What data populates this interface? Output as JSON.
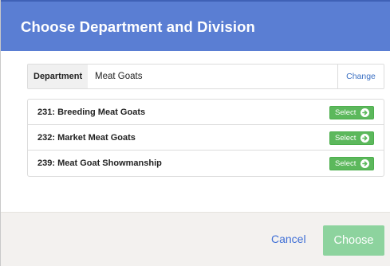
{
  "modal": {
    "title": "Choose Department and Division"
  },
  "department": {
    "label": "Department",
    "value": "Meat Goats",
    "change_label": "Change"
  },
  "divisions": [
    {
      "name": "231: Breeding Meat Goats",
      "select_label": "Select"
    },
    {
      "name": "232: Market Meat Goats",
      "select_label": "Select"
    },
    {
      "name": "239: Meat Goat Showmanship",
      "select_label": "Select"
    }
  ],
  "footer": {
    "cancel_label": "Cancel",
    "choose_label": "Choose"
  },
  "colors": {
    "header": "#5a7ed3",
    "select_button": "#5cb85c",
    "choose_button": "#8dd39e",
    "link": "#3f6fd6"
  },
  "icons": {
    "select": "circle-arrow-right-icon"
  }
}
